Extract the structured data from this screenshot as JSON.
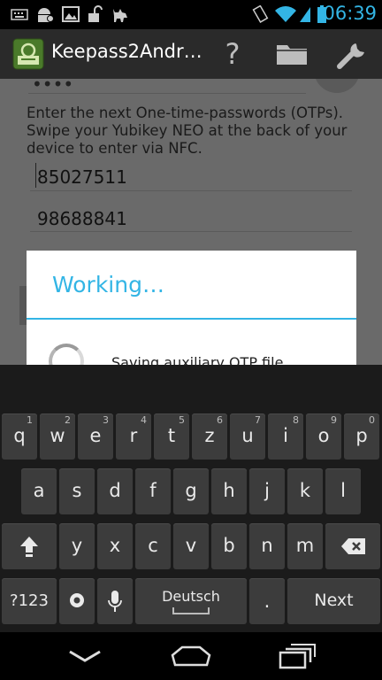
{
  "status_bar": {
    "time": "06:39",
    "icons": [
      "keyboard-icon",
      "android-icon",
      "image-icon",
      "unlock-icon",
      "deer-icon",
      "vibrate-icon",
      "wifi-icon",
      "signal-icon",
      "battery-icon"
    ]
  },
  "action_bar": {
    "title": "Keepass2Andr…",
    "icons": [
      "app-logo-icon",
      "help-icon",
      "folder-icon",
      "wrench-icon"
    ]
  },
  "content": {
    "password_masked": "••••",
    "prompt": "Enter the next One-time-passwords (OTPs). Swipe your Yubikey NEO at the back of your device to enter via NFC.",
    "otp_1": "85027511",
    "otp_2": "98688841"
  },
  "dialog": {
    "title": "Working…",
    "message": "Saving auxiliary OTP file…"
  },
  "keyboard": {
    "row1": [
      {
        "key": "q",
        "sup": "1"
      },
      {
        "key": "w",
        "sup": "2"
      },
      {
        "key": "e",
        "sup": "3"
      },
      {
        "key": "r",
        "sup": "4"
      },
      {
        "key": "t",
        "sup": "5"
      },
      {
        "key": "z",
        "sup": "6"
      },
      {
        "key": "u",
        "sup": "7"
      },
      {
        "key": "i",
        "sup": "8"
      },
      {
        "key": "o",
        "sup": "9"
      },
      {
        "key": "p",
        "sup": "0"
      }
    ],
    "row2": [
      "a",
      "s",
      "d",
      "f",
      "g",
      "h",
      "j",
      "k",
      "l"
    ],
    "row3": [
      "y",
      "x",
      "c",
      "v",
      "b",
      "n",
      "m"
    ],
    "symbols_label": "?123",
    "space_label": "Deutsch",
    "period_label": ".",
    "next_label": "Next"
  },
  "colors": {
    "accent": "#33b5e5"
  }
}
